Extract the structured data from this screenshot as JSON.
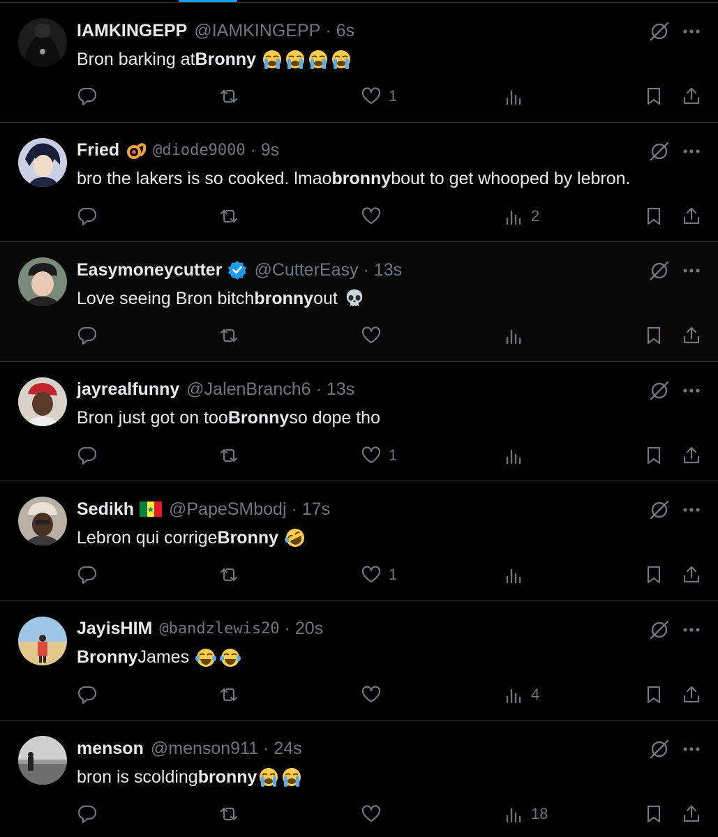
{
  "colors": {
    "background": "#000000",
    "text": "#e7e9ea",
    "muted": "#71767b",
    "divider": "#2f3336",
    "accent": "#1d9bf0"
  },
  "tweets": [
    {
      "name": "IAMKINGEPP",
      "handle": "@IAMKINGEPP",
      "time": "6s",
      "text_before": "Bron barking at ",
      "bold": "Bronny",
      "text_after": "",
      "emojis": [
        "loudly-crying-face",
        "loudly-crying-face",
        "loudly-crying-face",
        "loudly-crying-face"
      ],
      "likes": "1",
      "views": ""
    },
    {
      "name": "Fried",
      "handle": "@diode9000",
      "time": "9s",
      "text_before": "bro the lakers is so cooked. lmao ",
      "bold": "bronny",
      "text_after": " bout to get whooped by lebron.",
      "emojis": [],
      "likes": "",
      "views": "2"
    },
    {
      "name": "Easymoneycutter",
      "handle": "@CutterEasy",
      "time": "13s",
      "text_before": "Love seeing Bron bitch ",
      "bold": "bronny",
      "text_after": " out",
      "emojis": [
        "skull"
      ],
      "likes": "",
      "views": ""
    },
    {
      "name": "jayrealfunny",
      "handle": "@JalenBranch6",
      "time": "13s",
      "text_before": "Bron just got on too ",
      "bold": "Bronny",
      "text_after": " so dope tho",
      "emojis": [],
      "likes": "1",
      "views": ""
    },
    {
      "name": "Sedikh",
      "handle": "@PapeSMbodj",
      "time": "17s",
      "text_before": "Lebron qui corrige ",
      "bold": "Bronny",
      "text_after": "",
      "emojis": [
        "rolling-on-floor-laughing"
      ],
      "likes": "1",
      "views": ""
    },
    {
      "name": "JayisHIM",
      "handle": "@bandzlewis20",
      "time": "20s",
      "text_before": "",
      "bold": "Bronny",
      "text_after": " James",
      "emojis": [
        "face-with-tears-of-joy",
        "face-with-tears-of-joy"
      ],
      "likes": "",
      "views": "4"
    },
    {
      "name": "menson",
      "handle": "@menson911",
      "time": "24s",
      "text_before": "bron is scolding ",
      "bold": "bronny",
      "text_after": "",
      "emojis": [
        "loudly-crying-face",
        "loudly-crying-face"
      ],
      "likes": "",
      "views": "18"
    }
  ]
}
